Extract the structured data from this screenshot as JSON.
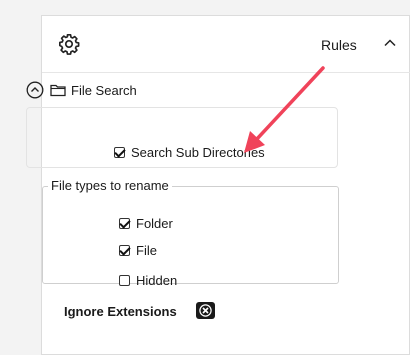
{
  "header": {
    "title": "Rules"
  },
  "file_search": {
    "title": "File Search",
    "search_sub_directories": {
      "label": "Search Sub Directories",
      "checked": true
    }
  },
  "file_types": {
    "legend": "File types to rename",
    "items": [
      {
        "label": "Folder",
        "checked": true
      },
      {
        "label": "File",
        "checked": true
      },
      {
        "label": "Hidden",
        "checked": false
      }
    ]
  },
  "ignore_extensions": {
    "label": "Ignore Extensions"
  },
  "icons": [
    "gear-icon",
    "chevron-up-icon",
    "circle-chevron-up-icon",
    "folder-icon",
    "clear-icon",
    "annotation-arrow"
  ],
  "colors": {
    "annotation_arrow": "#f0435a"
  }
}
